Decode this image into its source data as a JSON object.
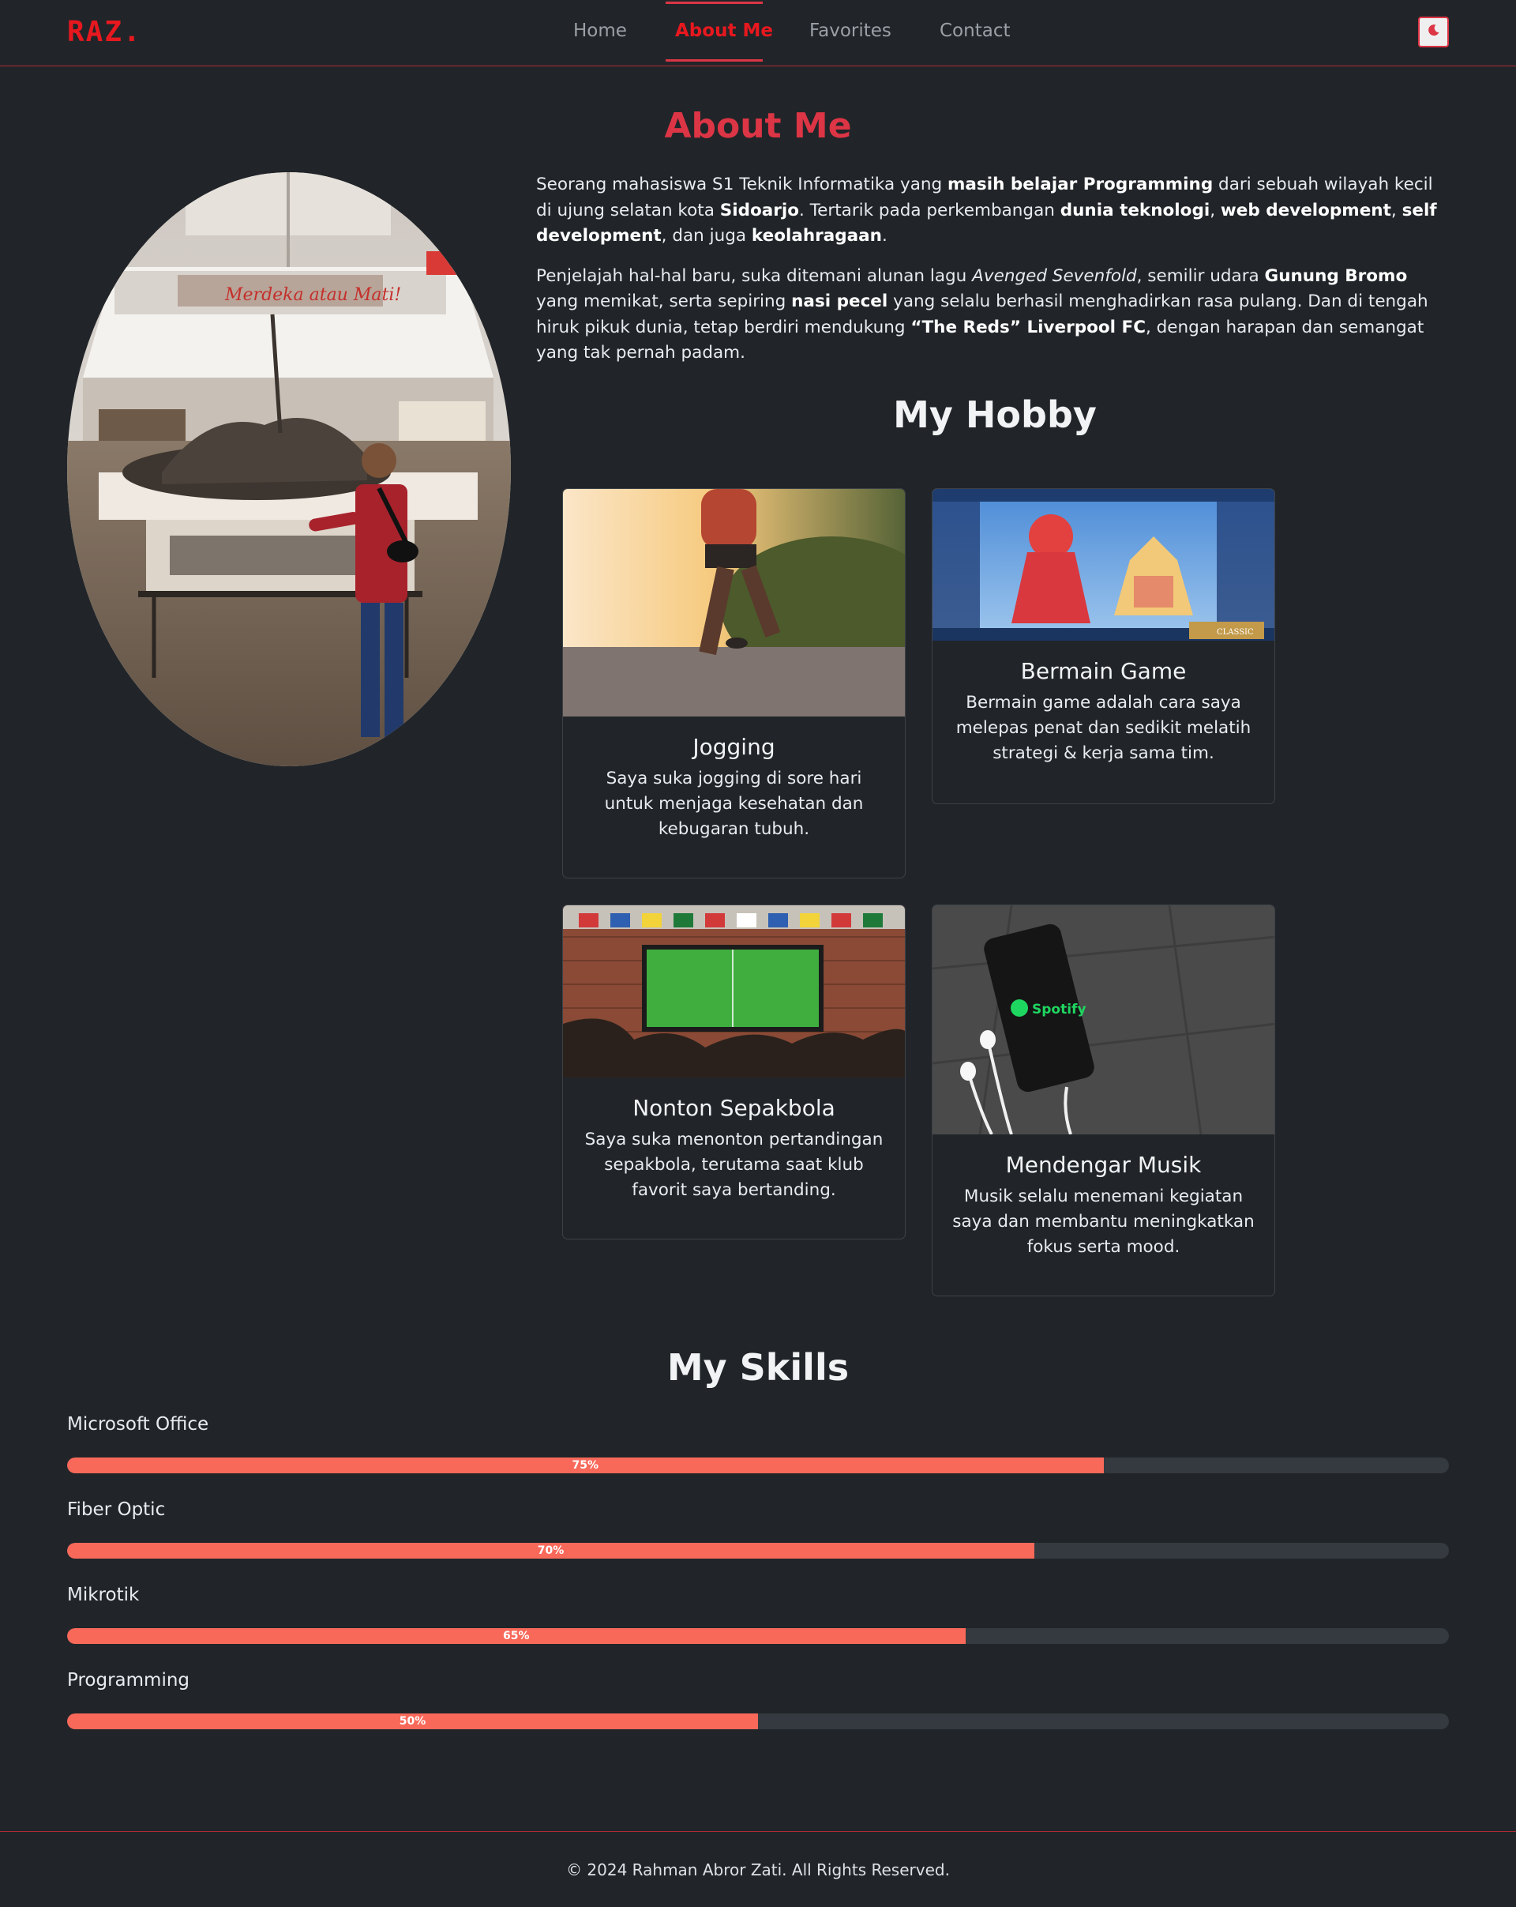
{
  "brand": "RAZ.",
  "nav": {
    "items": [
      {
        "label": "Home"
      },
      {
        "label": "About Me"
      },
      {
        "label": "Favorites"
      },
      {
        "label": "Contact"
      }
    ],
    "theme_icon": "moon-icon"
  },
  "colors": {
    "accent": "#dc3545",
    "brand": "#e8181f",
    "background": "#212529",
    "progress": "#f8695a"
  },
  "about": {
    "title": "About Me",
    "p1": [
      {
        "t": "Seorang mahasiswa S1 Teknik Informatika yang "
      },
      {
        "t": "masih belajar Programming",
        "b": true
      },
      {
        "t": " dari sebuah wilayah kecil di ujung selatan kota "
      },
      {
        "t": "Sidoarjo",
        "b": true
      },
      {
        "t": ". Tertarik pada perkembangan "
      },
      {
        "t": "dunia teknologi",
        "b": true
      },
      {
        "t": ", "
      },
      {
        "t": "web development",
        "b": true
      },
      {
        "t": ", "
      },
      {
        "t": "self development",
        "b": true
      },
      {
        "t": ", dan juga "
      },
      {
        "t": "keolahragaan",
        "b": true
      },
      {
        "t": "."
      }
    ],
    "p2": [
      {
        "t": "Penjelajah hal-hal baru, suka ditemani alunan lagu "
      },
      {
        "t": "Avenged Sevenfold",
        "i": true
      },
      {
        "t": ", semilir udara "
      },
      {
        "t": "Gunung Bromo",
        "b": true
      },
      {
        "t": " yang memikat, serta sepiring "
      },
      {
        "t": "nasi pecel",
        "b": true
      },
      {
        "t": " yang selalu berhasil menghadirkan rasa pulang. Dan di tengah hiruk pikuk dunia, tetap berdiri mendukung "
      },
      {
        "t": "“The Reds” Liverpool FC",
        "b": true
      },
      {
        "t": ", dengan harapan dan semangat yang tak pernah padam."
      }
    ]
  },
  "hobby": {
    "title": "My Hobby",
    "cards": [
      {
        "title": "Jogging",
        "text": "Saya suka jogging di sore hari untuk menjaga kesehatan dan kebugaran tubuh."
      },
      {
        "title": "Bermain Game",
        "text": "Bermain game adalah cara saya melepas penat dan sedikit melatih strategi & kerja sama tim."
      },
      {
        "title": "Nonton Sepakbola",
        "text": "Saya suka menonton pertandingan sepakbola, terutama saat klub favorit saya bertanding."
      },
      {
        "title": "Mendengar Musik",
        "text": "Musik selalu menemani kegiatan saya dan membantu meningkatkan fokus serta mood."
      }
    ],
    "game_badge": "CLASSIC",
    "music_logo": "Spotify"
  },
  "skills": {
    "title": "My Skills",
    "items": [
      {
        "name": "Microsoft Office",
        "percent": 75,
        "label": "75%"
      },
      {
        "name": "Fiber Optic",
        "percent": 70,
        "label": "70%"
      },
      {
        "name": "Mikrotik",
        "percent": 65,
        "label": "65%"
      },
      {
        "name": "Programming",
        "percent": 50,
        "label": "50%"
      }
    ]
  },
  "footer": {
    "text": "© 2024 Rahman Abror Zati. All Rights Reserved."
  }
}
